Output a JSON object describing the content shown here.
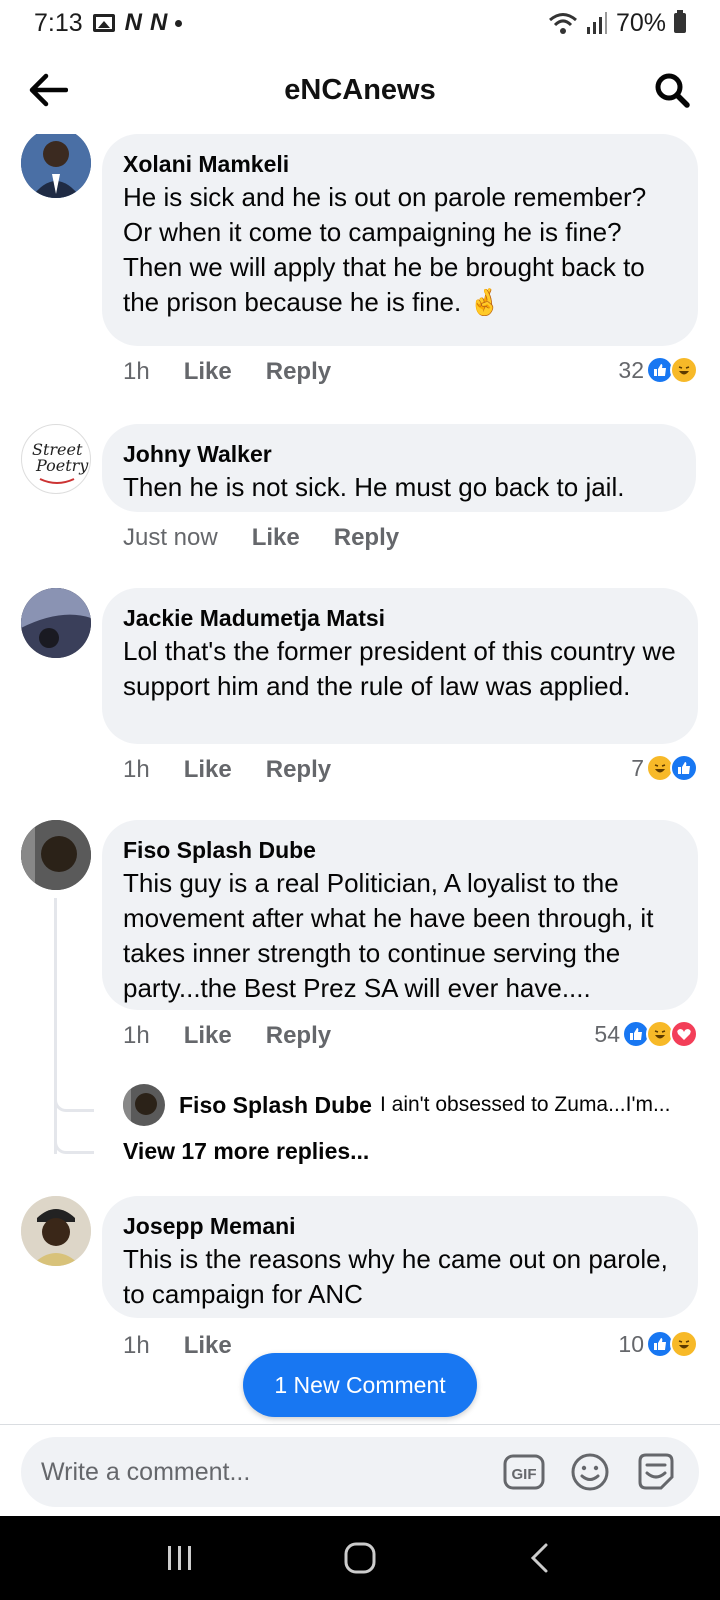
{
  "status_bar": {
    "time": "7:13",
    "battery": "70%"
  },
  "header": {
    "title": "eNCAnews"
  },
  "comments": [
    {
      "author": "Xolani Mamkeli",
      "text": "He is sick and he is out on parole remember? Or when it come to campaigning he is fine? Then we will apply that he be brought back to the prison because he is fine. 🤞",
      "time": "1h",
      "like": "Like",
      "reply": "Reply",
      "reaction_count": "32"
    },
    {
      "author": "Johny Walker",
      "text": "Then he is not sick. He must go back to jail.",
      "time": "Just now",
      "like": "Like",
      "reply": "Reply"
    },
    {
      "author": "Jackie Madumetja Matsi",
      "text": "Lol that's the former president of this country we support him and the rule of law was applied.",
      "time": "1h",
      "like": "Like",
      "reply": "Reply",
      "reaction_count": "7"
    },
    {
      "author": "Fiso Splash Dube",
      "text": "This guy is a real Politician, A loyalist to the movement after what he have been through, it takes inner strength to continue serving the party...the Best Prez SA will ever have....",
      "time": "1h",
      "like": "Like",
      "reply": "Reply",
      "reaction_count": "54",
      "reply_preview": {
        "author": "Fiso Splash Dube",
        "text": "I ain't obsessed to Zuma...I'm..."
      },
      "view_more": "View 17 more replies..."
    },
    {
      "author": "Josepp Memani",
      "text": "This is the reasons why he came out on parole, to campaign for ANC",
      "time": "1h",
      "like": "Like",
      "reaction_count": "10"
    }
  ],
  "new_comment_button": "1 New Comment",
  "composer": {
    "placeholder": "Write a comment...",
    "gif_label": "GIF"
  },
  "colors": {
    "accent": "#1877f2",
    "bubble": "#f0f2f5",
    "meta": "#65676b"
  }
}
